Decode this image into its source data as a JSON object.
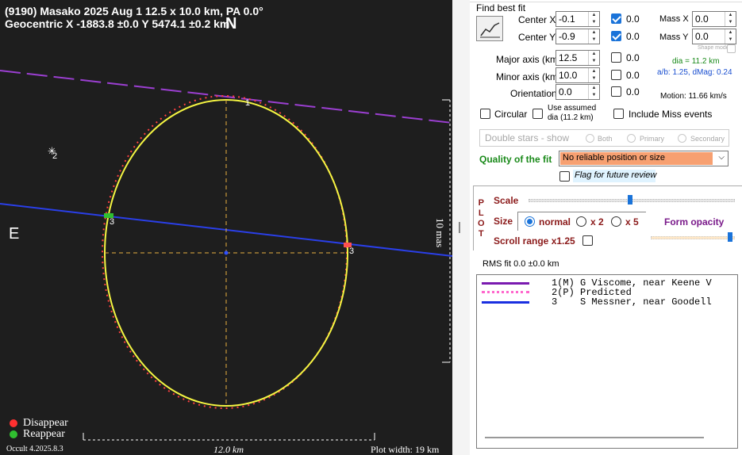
{
  "plot": {
    "header_line1": "(9190) Masako  2025 Aug 1   12.5 x 10.0 km, PA 0.0°",
    "header_line2": "Geocentric  X  -1883.8 ±0.0  Y 5474.1 ±0.2 km",
    "north_label": "N",
    "east_label": "E",
    "chord_labels": [
      "1",
      "2",
      "3",
      "3"
    ],
    "scale_vertical_label": "10 mas",
    "scale_horizontal_label": "12.0 km",
    "legend_disappear": "Disappear",
    "legend_reappear": "Reappear",
    "version": "Occult 4.2025.8.3",
    "plot_width_label": "Plot width: 19 km",
    "colors": {
      "background": "#1e1e1e",
      "fit_ellipse": "#f5f542",
      "predicted_ellipse": "#ff4040",
      "chord1": "#9b3fd1",
      "chord3": "#2a3fe8",
      "disappear": "#ff3030",
      "reappear": "#30c030"
    }
  },
  "panel": {
    "find_best_fit": "Find best fit",
    "center_x": {
      "label": "Center X",
      "value": "-0.1",
      "check_on": true,
      "check_value": "0.0"
    },
    "center_y": {
      "label": "Center Y",
      "value": "-0.9",
      "check_on": true,
      "check_value": "0.0"
    },
    "major_axis": {
      "label": "Major axis (km)",
      "value": "12.5",
      "check_on": false,
      "check_value": "0.0"
    },
    "minor_axis": {
      "label": "Minor axis (km)",
      "value": "10.0",
      "check_on": false,
      "check_value": "0.0"
    },
    "orientation": {
      "label": "Orientation",
      "value": "0.0",
      "check_on": false,
      "check_value": "0.0"
    },
    "mass_x": {
      "label": "Mass X",
      "value": "0.0"
    },
    "mass_y": {
      "label": "Mass Y",
      "value": "0.0"
    },
    "shape_model": "Shape model",
    "dia": "dia = 11.2 km",
    "ab_dmag": "a/b: 1.25, dMag: 0.24",
    "motion": "Motion: 11.66 km/s",
    "circular": "Circular",
    "use_assumed_l1": "Use assumed",
    "use_assumed_l2": "dia (11.2 km)",
    "include_miss": "Include Miss events",
    "double_stars": "Double stars - show",
    "ds_both": "Both",
    "ds_primary": "Primary",
    "ds_secondary": "Secondary",
    "quality_label": "Quality of the fit",
    "quality_value": "No reliable position or size",
    "quality_color": "#f7a071",
    "flag_review": "Flag for future review",
    "plot_letters": [
      "P",
      "L",
      "O",
      "T"
    ],
    "scale_label": "Scale",
    "size_label": "Size",
    "size_normal": "normal",
    "size_x2": "x 2",
    "size_x5": "x 5",
    "form_opacity": "Form opacity",
    "scroll_range": "Scroll range x1.25",
    "rms_fit": "RMS fit 0.0 ±0.0 km"
  },
  "observers": [
    {
      "code": "1(M)",
      "name": "G Viscome, near Keene V",
      "style": "solid",
      "color": "#7a1ab0"
    },
    {
      "code": "2(P)",
      "name": "Predicted",
      "style": "dotted",
      "color": "#ff66cc"
    },
    {
      "code": "3",
      "name": "S Messner, near Goodell",
      "style": "solid",
      "color": "#1a2fe0"
    }
  ]
}
